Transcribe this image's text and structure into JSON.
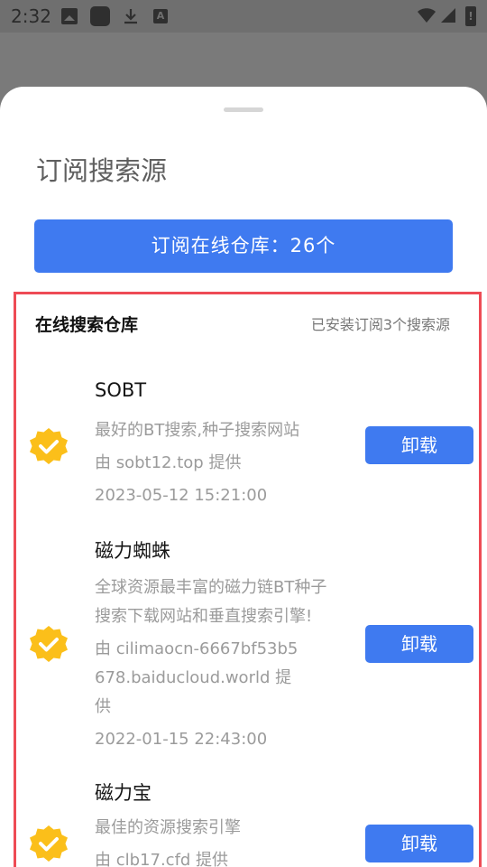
{
  "status_bar": {
    "time": "2:32",
    "badge_a": "A",
    "battery_glyph": "!"
  },
  "sheet": {
    "title": "订阅搜索源",
    "subscribe_button": "订阅在线仓库：26个"
  },
  "repo": {
    "title": "在线搜索仓库",
    "status": "已安装订阅3个搜索源",
    "items": [
      {
        "name": "SOBT",
        "description": "最好的BT搜索,种子搜索网站",
        "provider": "由 sobt12.top 提供",
        "date": "2023-05-12 15:21:00",
        "action": "卸载"
      },
      {
        "name": "磁力蜘蛛",
        "description_line1": "全球资源最丰富的磁力链BT种子",
        "description_line2": "搜索下载网站和垂直搜索引擎!",
        "provider_line1": "由 cilimaocn-6667bf53b5",
        "provider_line2": "678.baiducloud.world 提",
        "provider_line3": "供",
        "date": "2022-01-15 22:43:00",
        "action": "卸载"
      },
      {
        "name": "磁力宝",
        "description": "最佳的资源搜索引擎",
        "provider": "由 clb17.cfd 提供",
        "action": "卸载"
      }
    ]
  },
  "colors": {
    "accent": "#3f7af0",
    "verified": "#fbbf1a",
    "highlight_border": "#ee4b55"
  }
}
